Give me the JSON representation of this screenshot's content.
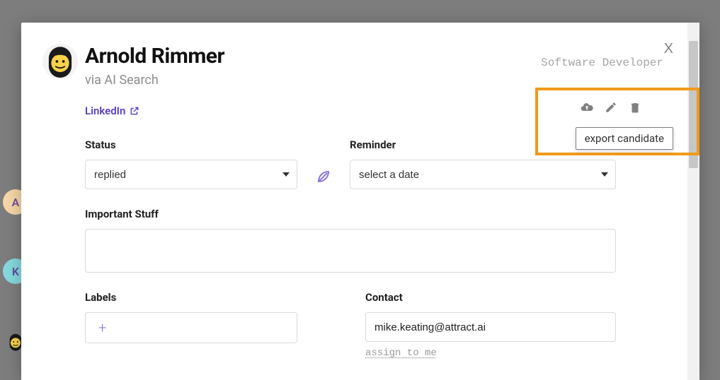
{
  "candidate": {
    "name": "Arnold Rimmer",
    "source": "via AI Search",
    "role": "Software Developer",
    "linkedin_label": "LinkedIn"
  },
  "tooltip": {
    "export": "export candidate"
  },
  "fields": {
    "status": {
      "label": "Status",
      "value": "replied"
    },
    "reminder": {
      "label": "Reminder",
      "placeholder": "select a date"
    },
    "important": {
      "label": "Important Stuff"
    },
    "labels": {
      "label": "Labels",
      "add_symbol": "+"
    },
    "contact": {
      "label": "Contact",
      "value": "mike.keating@attract.ai",
      "assign": "assign to me"
    }
  },
  "left_chips": {
    "a": "A",
    "k": "K"
  },
  "close": "X"
}
